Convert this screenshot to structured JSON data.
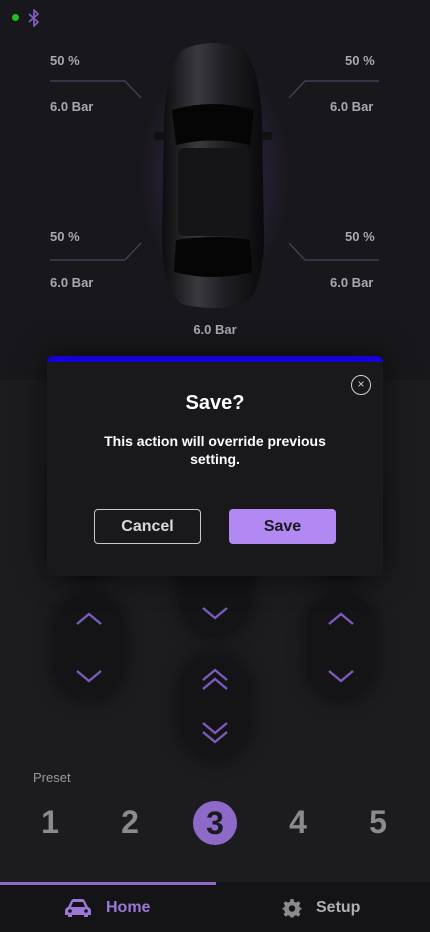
{
  "status": {
    "connection_dot_color": "#1fc11f",
    "bluetooth_icon": "bluetooth-icon"
  },
  "tires": {
    "front_left": {
      "percent": "50 %",
      "pressure": "6.0 Bar"
    },
    "front_right": {
      "percent": "50 %",
      "pressure": "6.0 Bar"
    },
    "rear_left": {
      "percent": "50 %",
      "pressure": "6.0 Bar"
    },
    "rear_right": {
      "percent": "50 %",
      "pressure": "6.0 Bar"
    }
  },
  "center_pressure": "6.0 Bar",
  "modal": {
    "title": "Save?",
    "message": "This action will override previous setting.",
    "cancel_label": "Cancel",
    "save_label": "Save",
    "close_symbol": "×",
    "accent_color": "#1400d6"
  },
  "preset": {
    "label": "Preset",
    "options": [
      "1",
      "2",
      "3",
      "4",
      "5"
    ],
    "selected": "3"
  },
  "nav": {
    "home_label": "Home",
    "setup_label": "Setup",
    "active": "Home",
    "accent_color": "#8e6ac8"
  }
}
